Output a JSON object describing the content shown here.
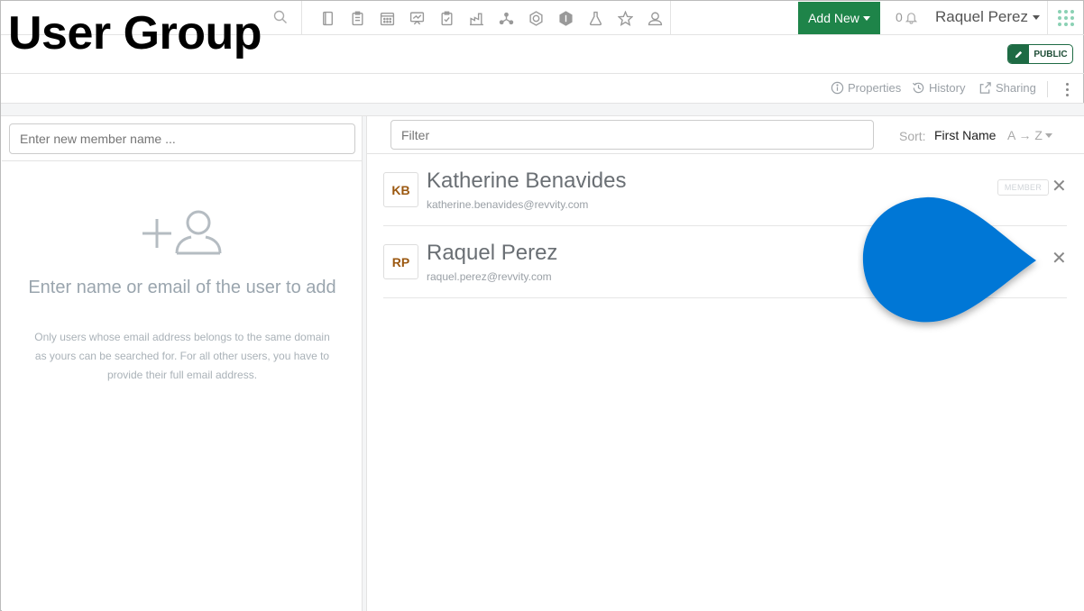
{
  "page": {
    "title": "User Group"
  },
  "topbar": {
    "tool_icons": [
      "notebook-icon",
      "clipboard-icon",
      "calendar-icon",
      "presentation-icon",
      "checklist-icon",
      "lab-icon",
      "network-icon",
      "hexagon-icon",
      "shield-icon",
      "flask-icon",
      "star-icon",
      "user-icon"
    ],
    "add_new_label": "Add New",
    "notification_count": "0",
    "user_name": "Raquel Perez",
    "accent_color": "#1e8449"
  },
  "header": {
    "visibility_badge": "PUBLIC"
  },
  "actions": {
    "properties": "Properties",
    "history": "History",
    "sharing": "Sharing"
  },
  "left": {
    "member_input_placeholder": "Enter new member name ...",
    "empty_title": "Enter name or email of the user to add",
    "empty_help": "Only users whose email address belongs to the same domain as yours can be searched for. For all other users, you have to provide their full email address."
  },
  "right": {
    "filter_placeholder": "Filter",
    "sort_label": "Sort:",
    "sort_field": "First Name",
    "sort_direction": "A → Z",
    "members": [
      {
        "initials": "KB",
        "name": "Katherine Benavides",
        "email": "katherine.benavides@revvity.com",
        "role": "MEMBER"
      },
      {
        "initials": "RP",
        "name": "Raquel Perez",
        "email": "raquel.perez@revvity.com",
        "role": ""
      }
    ]
  }
}
